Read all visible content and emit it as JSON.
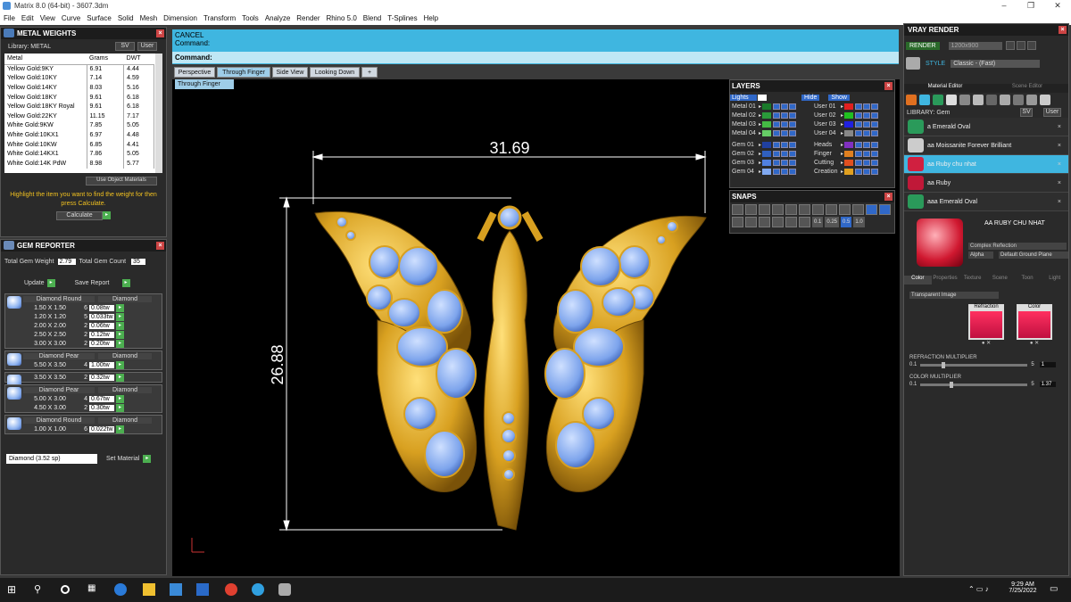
{
  "app": {
    "title": "Matrix 8.0 (64-bit) - 3607.3dm"
  },
  "menu": [
    "File",
    "Edit",
    "View",
    "Curve",
    "Surface",
    "Solid",
    "Mesh",
    "Dimension",
    "Transform",
    "Tools",
    "Analyze",
    "Render",
    "Rhino 5.0",
    "Blend",
    "T-Splines",
    "Help"
  ],
  "metal": {
    "title": "METAL WEIGHTS",
    "library_label": "Library: METAL",
    "sv": "SV",
    "user": "User",
    "headers": [
      "Metal",
      "Grams",
      "DWT"
    ],
    "rows": [
      [
        "Yellow Gold:9KY",
        "6.91",
        "4.44"
      ],
      [
        "Yellow Gold:10KY",
        "7.14",
        "4.59"
      ],
      [
        "Yellow Gold:14KY",
        "8.03",
        "5.16"
      ],
      [
        "Yellow Gold:18KY",
        "9.61",
        "6.18"
      ],
      [
        "Yellow Gold:18KY Royal",
        "9.61",
        "6.18"
      ],
      [
        "Yellow Gold:22KY",
        "11.15",
        "7.17"
      ],
      [
        "White Gold:9KW",
        "7.85",
        "5.05"
      ],
      [
        "White Gold:10KX1",
        "6.97",
        "4.48"
      ],
      [
        "White Gold:10KW",
        "6.85",
        "4.41"
      ],
      [
        "White Gold:14KX1",
        "7.86",
        "5.05"
      ],
      [
        "White Gold:14K PdW",
        "8.98",
        "5.77"
      ]
    ],
    "use_object": "Use Object Materials",
    "hint": "Highlight the item you want to find the weight for then press Calculate.",
    "calculate": "Calculate"
  },
  "gem": {
    "title": "GEM REPORTER",
    "total_weight_label": "Total Gem Weight",
    "total_weight": "2.79",
    "total_count_label": "Total Gem Count",
    "total_count": "35",
    "update": "Update",
    "save_report": "Save Report",
    "groups": [
      {
        "cut": "Diamond Round",
        "mat": "Diamond",
        "rows": [
          [
            "1.50 X 1.50",
            "6",
            "0.08tw"
          ],
          [
            "1.20 X 1.20",
            "5",
            "0.033tw"
          ],
          [
            "2.00 X 2.00",
            "2",
            "0.06tw"
          ],
          [
            "2.50 X 2.50",
            "2",
            "0.12tw"
          ],
          [
            "3.00 X 3.00",
            "2",
            "0.20tw"
          ]
        ]
      },
      {
        "cut": "Diamond Pear",
        "mat": "Diamond",
        "rows": [
          [
            "5.50 X 3.50",
            "4",
            "1.00tw"
          ]
        ]
      },
      {
        "cut": "",
        "mat": "",
        "rows": [
          [
            "3.50 X 3.50",
            "2",
            "0.32tw"
          ]
        ]
      },
      {
        "cut": "Diamond Pear",
        "mat": "Diamond",
        "rows": [
          [
            "5.00 X 3.00",
            "4",
            "0.67tw"
          ],
          [
            "4.50 X 3.00",
            "2",
            "0.30tw"
          ]
        ]
      },
      {
        "cut": "Diamond Round",
        "mat": "Diamond",
        "rows": [
          [
            "1.00 X 1.00",
            "6",
            "0.022tw"
          ]
        ]
      }
    ],
    "select": "Diamond    (3.52 sp)",
    "set_material": "Set Material"
  },
  "command": {
    "line1": "CANCEL",
    "line2": "Command:",
    "prompt": "Command:"
  },
  "tabs": [
    "Perspective",
    "Through Finger",
    "Side View",
    "Looking Down"
  ],
  "viewport_label": "Through Finger",
  "dims": {
    "width": "31.69",
    "height": "26.88"
  },
  "layers": {
    "title": "LAYERS",
    "lights": "Lights",
    "hide": "Hide",
    "show": "Show",
    "left": [
      [
        "Metal 01",
        "#1a7a2a"
      ],
      [
        "Metal 02",
        "#2a9a3a"
      ],
      [
        "Metal 03",
        "#44bb44"
      ],
      [
        "Metal 04",
        "#66cc66"
      ],
      [
        "Gem 01",
        "#2040a0"
      ],
      [
        "Gem 02",
        "#3060c0"
      ],
      [
        "Gem 03",
        "#5080e0"
      ],
      [
        "Gem 04",
        "#80a8f0"
      ]
    ],
    "right": [
      [
        "User 01",
        "#e02020"
      ],
      [
        "User 02",
        "#20c020"
      ],
      [
        "User 03",
        "#2020e0"
      ],
      [
        "User 04",
        "#888888"
      ],
      [
        "Heads",
        "#8030c0"
      ],
      [
        "Finger",
        "#e08020"
      ],
      [
        "Cutting",
        "#e05020"
      ],
      [
        "Creation",
        "#e0a020"
      ]
    ]
  },
  "snaps": {
    "title": "SNAPS",
    "values": [
      "0.1",
      "0.25",
      "0.5",
      "1.0"
    ]
  },
  "vray": {
    "title": "VRAY RENDER",
    "render": "RENDER",
    "res": "1200x900",
    "style_label": "STYLE",
    "style_value": "Classic - (Fast)",
    "tabs": [
      "Material Editor",
      "Scene Editor"
    ],
    "library": "LIBRARY: Gem",
    "sv": "SV",
    "user": "User",
    "materials": [
      [
        "a Emerald Oval",
        "#2a9a5a"
      ],
      [
        "aa Moissanite Forever Brilliant",
        "#cccccc"
      ],
      [
        "aa Ruby chu nhat",
        "#d02040"
      ],
      [
        "aa Ruby",
        "#c01838"
      ],
      [
        "aaa Emerald Oval",
        "#2a9a5a"
      ]
    ],
    "selected_name": "AA RUBY CHU NHAT",
    "complex": "Complex Reflection",
    "alpha": "Alpha",
    "ground": "Default Ground Plane",
    "subtabs": [
      "Color",
      "Properties",
      "Texture",
      "Scene",
      "Toon",
      "Light"
    ],
    "transparent": "Transparent Image",
    "refraction": "Refraction",
    "color": "Color",
    "refr_mult": "REFRACTION MULTIPLIER",
    "refr_min": "0.1",
    "refr_max": "5",
    "refr_val": "1",
    "col_mult": "COLOR MULTIPLIER",
    "col_min": "0.1",
    "col_max": "5",
    "col_val": "1.37"
  },
  "taskbar": {
    "time": "9:29 AM",
    "date": "7/25/2022"
  },
  "colors": {
    "accent": "#3fb6e0",
    "gold": "#e0b030",
    "gem": "#8fb4f0"
  }
}
